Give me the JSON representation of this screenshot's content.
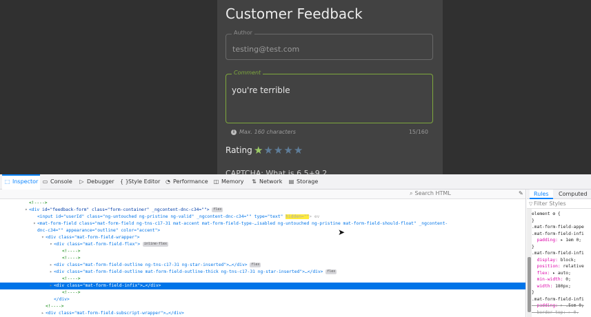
{
  "app": {
    "title": "Customer Feedback",
    "author": {
      "label": "Author",
      "value": "testing@test.com"
    },
    "comment": {
      "label": "Comment",
      "value": "you're terrible"
    },
    "hint": {
      "icon": "info-icon",
      "text": "Max. 160 characters",
      "counter": "15/160"
    },
    "rating": {
      "label": "Rating",
      "value": 1,
      "max": 5
    },
    "captcha": "CAPTCHA:  What is  6  5+9 2"
  },
  "devtools": {
    "tabs": [
      {
        "label": "Inspector",
        "icon": "inspector-icon"
      },
      {
        "label": "Console",
        "icon": "console-icon"
      },
      {
        "label": "Debugger",
        "icon": "debugger-icon"
      },
      {
        "label": "Style Editor",
        "icon": "style-editor-icon"
      },
      {
        "label": "Performance",
        "icon": "performance-icon"
      },
      {
        "label": "Memory",
        "icon": "memory-icon"
      },
      {
        "label": "Network",
        "icon": "network-icon"
      },
      {
        "label": "Storage",
        "icon": "storage-icon"
      }
    ],
    "search_placeholder": "Search HTML",
    "markup": [
      {
        "indent": 3,
        "text": "<!---->",
        "kind": "comment"
      },
      {
        "indent": 3,
        "tw": "▾",
        "pre": "<div ",
        "attrs": "id=\"feedback-form\" class=\"form-container\" _ngcontent-dnc-c34=\"\">",
        "badge": "flex"
      },
      {
        "indent": 4,
        "dim": true,
        "text": "<input id=\"userId\" class=\"ng-untouched ng-pristine ng-valid\" _ngcontent-dnc-c34=\"\" type=\"text\" ",
        "hl": "hidden=\"\"",
        "tail": "> ev"
      },
      {
        "indent": 4,
        "tw": "▾",
        "text": "<mat-form-field class=\"mat-form-field ng-tns-c17-31 mat-accent mat-form-field-type-…isabled ng-untouched ng-pristine mat-form-field-should-float\" _ngcontent-"
      },
      {
        "indent": 4,
        "text": "dnc-c34=\"\" appearance=\"outline\" color=\"accent\">"
      },
      {
        "indent": 5,
        "tw": "▾",
        "text": "<div class=\"mat-form-field-wrapper\">"
      },
      {
        "indent": 6,
        "tw": "▾",
        "text": "<div class=\"mat-form-field-flex\">",
        "badge": "inline-flex"
      },
      {
        "indent": 7,
        "text": "<!---->",
        "kind": "comment"
      },
      {
        "indent": 7,
        "text": "<!---->",
        "kind": "comment"
      },
      {
        "indent": 6,
        "tw": "▸",
        "text": "<div class=\"mat-form-field-outline ng-tns-c17-31 ng-star-inserted\">…</div>",
        "badge": "flex"
      },
      {
        "indent": 6,
        "tw": "▸",
        "text": "<div class=\"mat-form-field-outline mat-form-field-outline-thick ng-tns-c17-31 ng-star-inserted\">…</div>",
        "badge": "flex"
      },
      {
        "indent": 7,
        "text": "<!---->",
        "kind": "comment"
      },
      {
        "indent": 6,
        "tw": "▸",
        "text": "<div class=\"mat-form-field-infix\">…</div>",
        "selected": true
      },
      {
        "indent": 7,
        "text": "<!---->",
        "kind": "comment"
      },
      {
        "indent": 6,
        "text": "</div>"
      },
      {
        "indent": 5,
        "text": "<!---->",
        "kind": "comment"
      },
      {
        "indent": 5,
        "tw": "▸",
        "text": "<div class=\"mat-form-field-subscript-wrapper\">…</div>"
      },
      {
        "indent": 5,
        "text": "</div>"
      }
    ],
    "rules_tabs": [
      "Rules",
      "Computed"
    ],
    "filter_placeholder": "Filter Styles",
    "rules": [
      {
        "text": "element ⚙ {"
      },
      {
        "text": "}"
      },
      {
        "text": ".mat-form-field-appe"
      },
      {
        "text": ".mat-form-field-infi"
      },
      {
        "prop": "  padding:",
        "val": " ▸ 1em 0;"
      },
      {
        "text": "}"
      },
      {
        "text": ".mat-form-field-infi"
      },
      {
        "prop": "  display:",
        "val": " block;"
      },
      {
        "prop": "  position:",
        "val": " relative"
      },
      {
        "prop": "  flex:",
        "val": " ▸ auto;"
      },
      {
        "prop": "  min-width:",
        "val": " 0;"
      },
      {
        "prop": "  width:",
        "val": " 180px;"
      },
      {
        "text": "}"
      },
      {
        "text": ".mat-form-field-infi"
      },
      {
        "prop": "  padding:",
        "val": " ▸ .5em 0;",
        "strike": true
      },
      {
        "text": "  border-top: ▸ 0.",
        "strike": true
      }
    ]
  }
}
